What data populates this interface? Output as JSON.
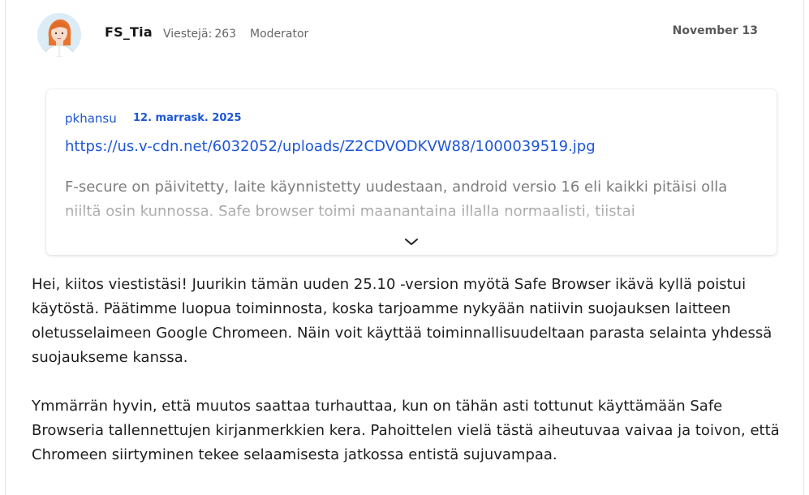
{
  "post": {
    "author": "FS_Tia",
    "post_count_label": "Viestejä:",
    "post_count": "263",
    "role": "Moderator",
    "date": "November 13"
  },
  "quote": {
    "author": "pkhansu",
    "date": "12. marrask. 2025",
    "link": "https://us.v-cdn.net/6032052/uploads/Z2CDVODKVW88/1000039519.jpg",
    "body": "F-secure on päivitetty, laite käynnistetty uudestaan, android versio 16 eli kaikki pitäisi olla niiltä osin kunnossa. Safe browser toimi maanantaina illalla normaalisti, tiistai"
  },
  "body": {
    "paragraph_1": "Hei, kiitos viestistäsi! Juurikin tämän uuden 25.10 -version myötä Safe Browser ikävä kyllä poistui käytöstä. Päätimme luopua toiminnosta, koska tarjoamme nykyään natiivin suojauksen laitteen oletusselaimeen Google Chromeen. Näin voit käyttää toiminnallisuudeltaan parasta selainta yhdessä suojaukseme kanssa.",
    "paragraph_2": "Ymmärrän hyvin, että muutos saattaa turhauttaa, kun on tähän asti tottunut käyttämään Safe Browseria tallennettujen kirjanmerkkien kera. Pahoittelen vielä tästä aiheutuvaa vaivaa ja toivon, että Chromeen siirtyminen tekee selaamisesta jatkossa entistä sujuvampaa."
  },
  "icons": {
    "avatar": "moderator-avatar",
    "expand": "chevron-down-icon"
  },
  "colors": {
    "link": "#1d56d6",
    "text": "#1e1e1e",
    "muted": "#666666"
  }
}
